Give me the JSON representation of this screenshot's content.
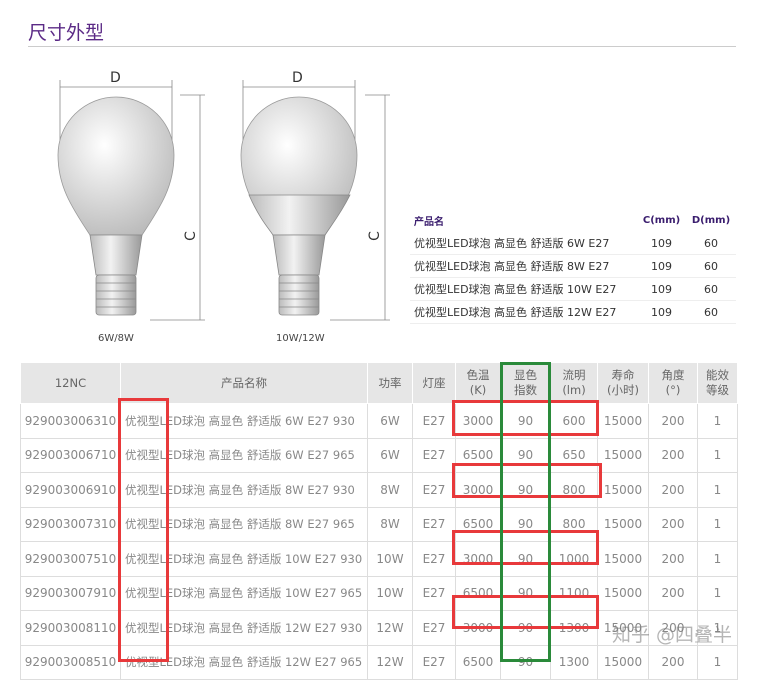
{
  "title": "尺寸外型",
  "drawings": {
    "dim_d": "D",
    "dim_c": "C",
    "left_caption": "6W/8W",
    "right_caption": "10W/12W"
  },
  "dimensions": {
    "headers": [
      "产品名",
      "C(mm)",
      "D(mm)"
    ],
    "rows": [
      [
        "优视型LED球泡 高显色 舒适版 6W E27",
        "109",
        "60"
      ],
      [
        "优视型LED球泡 高显色 舒适版 8W E27",
        "109",
        "60"
      ],
      [
        "优视型LED球泡 高显色 舒适版 10W E27",
        "109",
        "60"
      ],
      [
        "优视型LED球泡 高显色 舒适版 12W E27",
        "109",
        "60"
      ]
    ]
  },
  "specs": {
    "headers": [
      "12NC",
      "产品名称",
      "功率",
      "灯座",
      "色温\n(K)",
      "显色\n指数",
      "流明\n(lm)",
      "寿命\n(小时)",
      "角度\n(°)",
      "能效\n等级"
    ],
    "rows": [
      [
        "929003006310",
        "优视型LED球泡 高显色 舒适版 6W E27 930",
        "6W",
        "E27",
        "3000",
        "90",
        "600",
        "15000",
        "200",
        "1"
      ],
      [
        "929003006710",
        "优视型LED球泡 高显色 舒适版 6W E27 965",
        "6W",
        "E27",
        "6500",
        "90",
        "650",
        "15000",
        "200",
        "1"
      ],
      [
        "929003006910",
        "优视型LED球泡 高显色 舒适版 8W E27 930",
        "8W",
        "E27",
        "3000",
        "90",
        "800",
        "15000",
        "200",
        "1"
      ],
      [
        "929003007310",
        "优视型LED球泡 高显色 舒适版 8W E27 965",
        "8W",
        "E27",
        "6500",
        "90",
        "800",
        "15000",
        "200",
        "1"
      ],
      [
        "929003007510",
        "优视型LED球泡 高显色 舒适版 10W E27 930",
        "10W",
        "E27",
        "3000",
        "90",
        "1000",
        "15000",
        "200",
        "1"
      ],
      [
        "929003007910",
        "优视型LED球泡 高显色 舒适版 10W E27 965",
        "10W",
        "E27",
        "6500",
        "90",
        "1100",
        "15000",
        "200",
        "1"
      ],
      [
        "929003008110",
        "优视型LED球泡 高显色 舒适版 12W E27 930",
        "12W",
        "E27",
        "3000",
        "90",
        "1300",
        "15000",
        "200",
        "1"
      ],
      [
        "929003008510",
        "优视型LED球泡 高显色 舒适版 12W E27 965",
        "12W",
        "E27",
        "6500",
        "90",
        "1300",
        "15000",
        "200",
        "1"
      ]
    ]
  },
  "watermark": "知乎 @四叠半",
  "colors": {
    "title": "#5b2a86",
    "highlight_red": "#e8393b",
    "highlight_green": "#2a8a3a"
  }
}
